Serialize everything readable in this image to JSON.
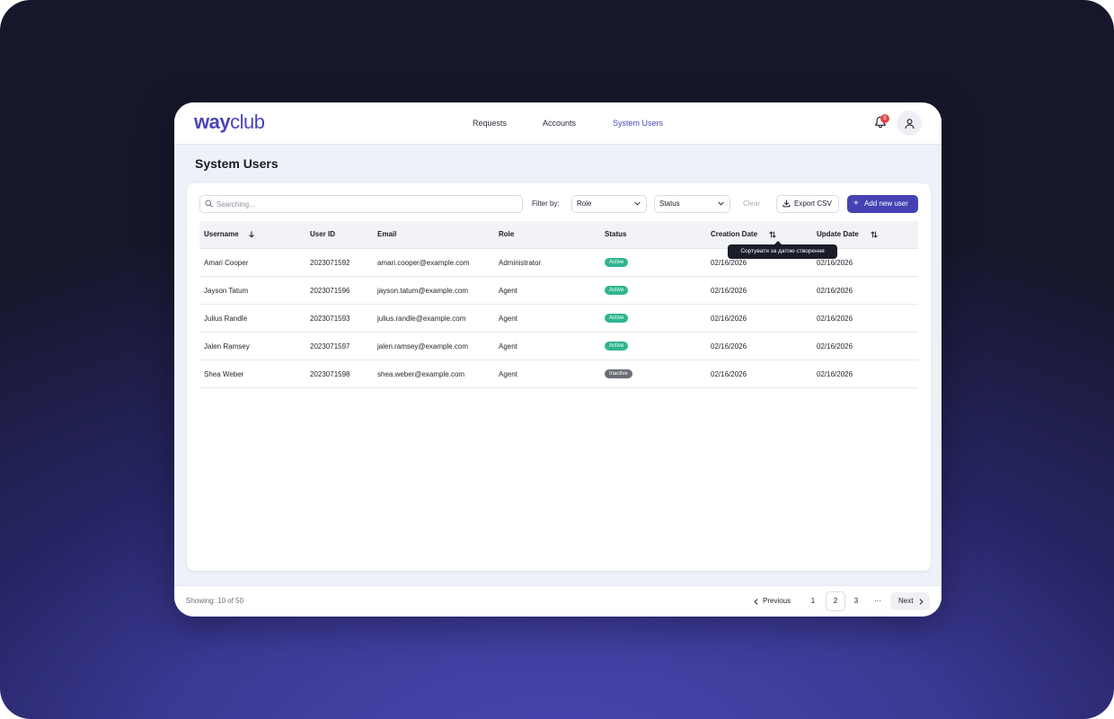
{
  "app": {
    "logo_way": "way",
    "logo_club": "club",
    "brand_color": "#4543b3"
  },
  "nav": {
    "items": [
      "Requests",
      "Accounts",
      "System Users"
    ],
    "active": "System Users"
  },
  "header": {
    "notification_count": "5",
    "bell_icon": "bell-icon",
    "user_icon": "user-icon"
  },
  "page": {
    "title": "System Users"
  },
  "toolbar": {
    "search_placeholder": "Searching...",
    "search_value": "",
    "filter_label": "Filter by:",
    "role_select": "Role",
    "status_select": "Status",
    "clear_label": "Clear",
    "export_label": "Export CSV",
    "add_label": "Add new user"
  },
  "table": {
    "columns": [
      "Username",
      "User ID",
      "Email",
      "Role",
      "Status",
      "Creation Date",
      "Update Date"
    ],
    "rows": [
      {
        "username": "Amari Cooper",
        "user_id": "2023071592",
        "email": "amari.cooper@example.com",
        "role": "Administrator",
        "status": "Active",
        "created": "02/16/2026",
        "updated": "02/16/2026"
      },
      {
        "username": "Jayson Tatum",
        "user_id": "2023071596",
        "email": "jayson.tatum@example.com",
        "role": "Agent",
        "status": "Active",
        "created": "02/16/2026",
        "updated": "02/16/2026"
      },
      {
        "username": "Julius Randle",
        "user_id": "2023071593",
        "email": "julius.randle@example.com",
        "role": "Agent",
        "status": "Active",
        "created": "02/16/2026",
        "updated": "02/16/2026"
      },
      {
        "username": "Jalen Ramsey",
        "user_id": "2023071597",
        "email": "jalen.ramsey@example.com",
        "role": "Agent",
        "status": "Active",
        "created": "02/16/2026",
        "updated": "02/16/2026"
      },
      {
        "username": "Shea Weber",
        "user_id": "2023071598",
        "email": "shea.weber@example.com",
        "role": "Agent",
        "status": "Inactive",
        "created": "02/16/2026",
        "updated": "02/16/2026"
      }
    ],
    "status_colors": {
      "Active": "#2fb58f",
      "Inactive": "#6b6d75"
    },
    "tooltip": "Сортувати за датою створення"
  },
  "footer": {
    "showing": "Showing: 10 of 50",
    "previous_label": "Previous",
    "pages": [
      "1",
      "2",
      "3"
    ],
    "current_page": "2",
    "ellipsis": "···",
    "next_label": "Next"
  }
}
